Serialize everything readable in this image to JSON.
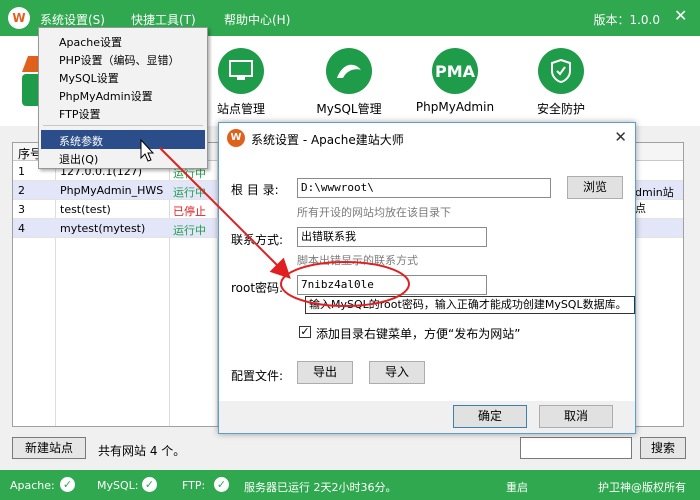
{
  "menubar": {
    "system_settings": "系统设置(S)",
    "quick_tools": "快捷工具(T)",
    "help_center": "帮助中心(H)",
    "version": "版本：1.0.0"
  },
  "tools": [
    {
      "label": "站点管理",
      "icon": "monitor-icon",
      "text": ""
    },
    {
      "label": "MySQL管理",
      "icon": "dolphin-icon",
      "text": ""
    },
    {
      "label": "PhpMyAdmin",
      "icon": "pma-icon",
      "text": "PMA"
    },
    {
      "label": "安全防护",
      "icon": "shield-icon",
      "text": ""
    }
  ],
  "table": {
    "header_first": "序号",
    "rows": [
      {
        "num": "1",
        "name": "127.0.0.1(127)",
        "status": "运行中",
        "status_color": "#1f9c4a"
      },
      {
        "num": "2",
        "name": "PhpMyAdmin_HWS",
        "status": "运行中",
        "status_color": "#1f9c4a",
        "extra": "dmin站点"
      },
      {
        "num": "3",
        "name": "test(test)",
        "status": "已停止",
        "status_color": "#e02020"
      },
      {
        "num": "4",
        "name": "mytest(mytest)",
        "status": "运行中",
        "status_color": "#1f9c4a"
      }
    ]
  },
  "bottom": {
    "new_site": "新建站点",
    "site_count": "共有网站 4 个。",
    "search": "搜索"
  },
  "statusbar": {
    "apache": "Apache:",
    "mysql": "MySQL:",
    "ftp": "FTP:",
    "server_status": "服务器已运行 2天2小时36分。",
    "restart": "重启",
    "copyright": "护卫神@版权所有"
  },
  "dropdown": {
    "items": [
      "Apache设置",
      "PHP设置（编码、显错）",
      "MySQL设置",
      "PhpMyAdmin设置",
      "FTP设置"
    ],
    "system_params": "系统参数",
    "exit": "退出(Q)"
  },
  "dialog": {
    "title": "系统设置 - Apache建站大师",
    "root_dir_label": "根 目 录:",
    "root_dir_value": "D:\\wwwroot\\",
    "root_dir_hint": "所有开设的网站均放在该目录下",
    "browse": "浏览",
    "contact_label": "联系方式:",
    "contact_value": "出错联系我",
    "contact_hint": "脚本出错显示的联系方式",
    "root_pwd_label": "root密码:",
    "root_pwd_value": "7nibz4al0le",
    "tooltip": "输入MySQL的root密码，输入正确才能成功创建MySQL数据库。",
    "checkbox_label": "添加目录右键菜单，方便“发布为网站”",
    "config_label": "配置文件:",
    "export": "导出",
    "import": "导入",
    "ok": "确定",
    "cancel": "取消"
  },
  "colors": {
    "brand_green": "#2fa84f",
    "dialog_border": "#5a9fd4",
    "highlight": "#2b4d8a",
    "annotation_red": "#e02020"
  }
}
